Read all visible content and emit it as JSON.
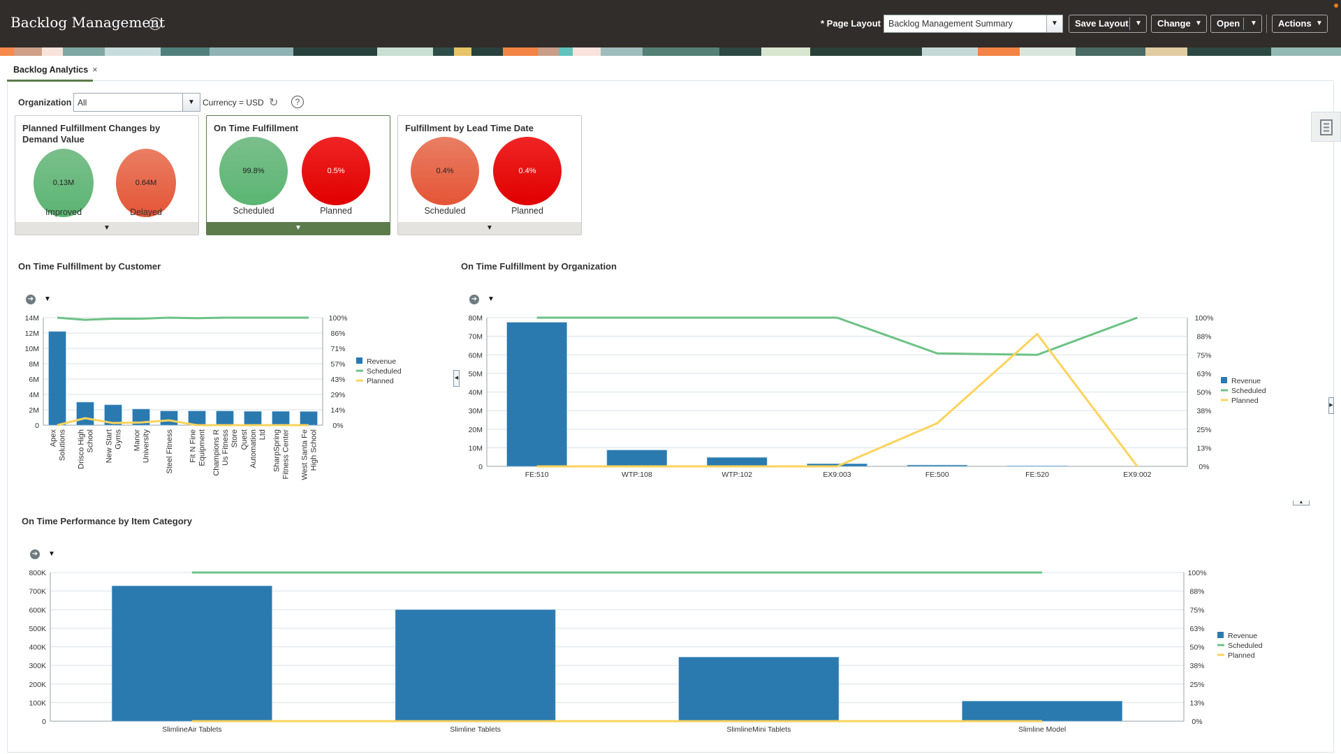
{
  "header": {
    "title": "Backlog Management",
    "help_icon": "question-circle-icon",
    "page_layout_label": "* Page Layout",
    "page_layout_value": "Backlog Management Summary",
    "buttons": {
      "save_layout": "Save Layout",
      "change": "Change",
      "open": "Open",
      "actions": "Actions"
    }
  },
  "tabs": [
    {
      "label": "Backlog Analytics",
      "close": "×"
    }
  ],
  "filters": {
    "organization_label": "Organization",
    "organization_value": "All",
    "currency": "Currency = USD"
  },
  "cards": [
    {
      "title": "Planned Fulfillment Changes by Demand Value",
      "metrics": [
        {
          "value": "0.13M",
          "label": "Improved",
          "color": "#5ab572"
        },
        {
          "value": "0.64M",
          "label": "Delayed",
          "color": "#e45535"
        }
      ]
    },
    {
      "title": "On Time Fulfillment",
      "selected": true,
      "metrics": [
        {
          "value": "99.8%",
          "label": "Scheduled",
          "color": "#5ab572"
        },
        {
          "value": "0.5%",
          "label": "Planned",
          "color": "#e00000"
        }
      ]
    },
    {
      "title": "Fulfillment by Lead Time Date",
      "metrics": [
        {
          "value": "0.4%",
          "label": "Scheduled",
          "color": "#e45535"
        },
        {
          "value": "0.4%",
          "label": "Planned",
          "color": "#e00000"
        }
      ]
    }
  ],
  "colors": {
    "revenue": "#2a7ab0",
    "scheduled": "#6cc285",
    "planned": "#fcd35c",
    "header_bg": "#312d2a",
    "accent_green": "#5c7c4b"
  },
  "chart_data": [
    {
      "id": "customer",
      "type": "bar",
      "title": "On Time Fulfillment by Customer",
      "categories": [
        "Apex Solutions",
        "Drisco High School",
        "New Start Gyms",
        "Manor University",
        "Steel Fitness",
        "Fit N Fine Equipment",
        "Champions R Us Fitness Store",
        "Quest Automation Ltd",
        "SharpSpring Fitness Center",
        "West Santa Fe High School"
      ],
      "category_lines": [
        [
          "Apex",
          "Solutions"
        ],
        [
          "Drisco High",
          "School"
        ],
        [
          "New Start",
          "Gyms"
        ],
        [
          "Manor",
          "University"
        ],
        [
          "Steel Fitness"
        ],
        [
          "Fit N Fine",
          "Equipment"
        ],
        [
          "Champions R",
          "Us Fitness",
          "Store"
        ],
        [
          "Quest",
          "Automation",
          "Ltd"
        ],
        [
          "SharpSpring",
          "Fitness Center"
        ],
        [
          "West Santa Fe",
          "High School"
        ]
      ],
      "series": [
        {
          "name": "Revenue",
          "axis": "left",
          "kind": "bar",
          "values": [
            12200000,
            3000000,
            2650000,
            2100000,
            1850000,
            1850000,
            1850000,
            1800000,
            1800000,
            1780000
          ]
        },
        {
          "name": "Scheduled",
          "axis": "right",
          "kind": "line",
          "values": [
            100,
            98,
            99,
            99,
            100,
            99.5,
            100,
            100,
            100,
            100
          ]
        },
        {
          "name": "Planned",
          "axis": "right",
          "kind": "line",
          "values": [
            0,
            6.5,
            2,
            2.5,
            4.5,
            0,
            0,
            0,
            0,
            0
          ]
        }
      ],
      "ylim": [
        0,
        14000000
      ],
      "yticks": [
        "0",
        "2M",
        "4M",
        "6M",
        "8M",
        "10M",
        "12M",
        "14M"
      ],
      "y2lim": [
        0,
        100
      ],
      "y2ticks": [
        "0%",
        "14%",
        "29%",
        "43%",
        "57%",
        "71%",
        "86%",
        "100%"
      ],
      "legend": [
        "Revenue",
        "Scheduled",
        "Planned"
      ],
      "legend_position": "right",
      "grid": true
    },
    {
      "id": "organization",
      "type": "bar",
      "title": "On Time Fulfillment by Organization",
      "categories": [
        "FE:510",
        "WTP:108",
        "WTP:102",
        "EX9:003",
        "FE:500",
        "FE:520",
        "EX9:002"
      ],
      "series": [
        {
          "name": "Revenue",
          "axis": "left",
          "kind": "bar",
          "values": [
            77500000,
            8800000,
            4800000,
            1400000,
            700000,
            300000,
            0
          ]
        },
        {
          "name": "Scheduled",
          "axis": "right",
          "kind": "line",
          "values": [
            100,
            100,
            100,
            100,
            76,
            75,
            100
          ]
        },
        {
          "name": "Planned",
          "axis": "right",
          "kind": "line",
          "values": [
            0,
            0,
            0,
            0,
            29,
            89,
            0
          ]
        }
      ],
      "ylim": [
        0,
        80000000
      ],
      "yticks": [
        "0",
        "10M",
        "20M",
        "30M",
        "40M",
        "50M",
        "60M",
        "70M",
        "80M"
      ],
      "y2lim": [
        0,
        100
      ],
      "y2ticks": [
        "0%",
        "13%",
        "25%",
        "38%",
        "50%",
        "63%",
        "75%",
        "88%",
        "100%"
      ],
      "legend": [
        "Revenue",
        "Scheduled",
        "Planned"
      ],
      "legend_position": "right",
      "grid": true
    },
    {
      "id": "item-category",
      "type": "bar",
      "title": "On Time Performance by Item Category",
      "categories": [
        "SlimlineAir Tablets",
        "Slimline Tablets",
        "SlimlineMini Tablets",
        "Slimline Model"
      ],
      "series": [
        {
          "name": "Revenue",
          "axis": "left",
          "kind": "bar",
          "values": [
            728000,
            600000,
            345000,
            108000
          ]
        },
        {
          "name": "Scheduled",
          "axis": "right",
          "kind": "line",
          "values": [
            100,
            100,
            100,
            100
          ]
        },
        {
          "name": "Planned",
          "axis": "right",
          "kind": "line",
          "values": [
            0,
            0,
            0,
            0
          ]
        }
      ],
      "ylim": [
        0,
        800000
      ],
      "yticks": [
        "0",
        "100K",
        "200K",
        "300K",
        "400K",
        "500K",
        "600K",
        "700K",
        "800K"
      ],
      "y2lim": [
        0,
        100
      ],
      "y2ticks": [
        "0%",
        "13%",
        "25%",
        "38%",
        "50%",
        "63%",
        "75%",
        "88%",
        "100%"
      ],
      "legend": [
        "Revenue",
        "Scheduled",
        "Planned"
      ],
      "legend_position": "right",
      "grid": true
    }
  ]
}
